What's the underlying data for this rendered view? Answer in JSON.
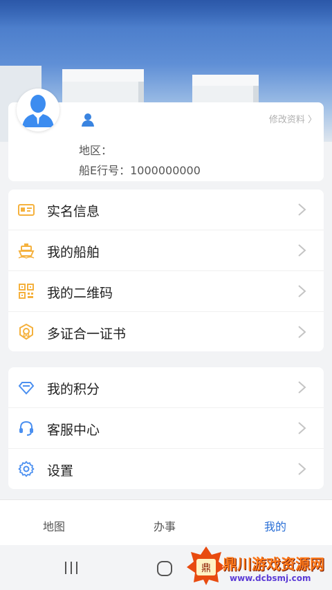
{
  "profile": {
    "edit_label": "修改资料 〉",
    "region_label": "地区：",
    "ship_no_label": "船E行号：1000000000"
  },
  "menu_group_1": [
    {
      "label": "实名信息",
      "icon": "id-card-icon"
    },
    {
      "label": "我的船舶",
      "icon": "ship-icon"
    },
    {
      "label": "我的二维码",
      "icon": "qr-code-icon"
    },
    {
      "label": "多证合一证书",
      "icon": "certificate-badge-icon"
    }
  ],
  "menu_group_2": [
    {
      "label": "我的积分",
      "icon": "diamond-icon"
    },
    {
      "label": "客服中心",
      "icon": "headset-icon"
    },
    {
      "label": "设置",
      "icon": "gear-icon"
    }
  ],
  "tabs": [
    {
      "label": "地图",
      "active": false
    },
    {
      "label": "办事",
      "active": false
    },
    {
      "label": "我的",
      "active": true
    }
  ],
  "watermark": {
    "title": "鼎川游戏资源网",
    "url": "www.dcbsmj.com"
  },
  "colors": {
    "accent": "#2a6fd6",
    "orange_icon": "#f5b13d",
    "blue_icon": "#4a8ff0"
  }
}
